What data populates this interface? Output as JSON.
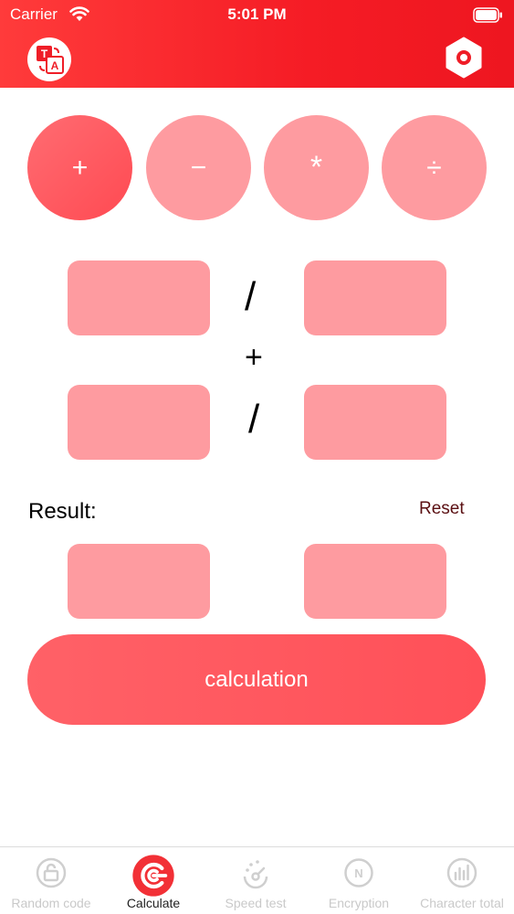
{
  "status_bar": {
    "carrier": "Carrier",
    "time": "5:01 PM"
  },
  "header": {
    "translate_icon": "translate-icon",
    "settings_icon": "hexagon-settings-icon"
  },
  "operators": [
    {
      "symbol": "+",
      "icon": "plus-icon",
      "selected": true
    },
    {
      "symbol": "−",
      "icon": "minus-icon",
      "selected": false
    },
    {
      "symbol": "*",
      "icon": "multiply-icon",
      "selected": false
    },
    {
      "symbol": "÷",
      "icon": "divide-icon",
      "selected": false
    }
  ],
  "fraction1": {
    "numerator": "",
    "denominator": "",
    "separator": "/"
  },
  "operation_symbol": "+",
  "fraction2": {
    "numerator": "",
    "denominator": "",
    "separator": "/"
  },
  "result": {
    "label": "Result:",
    "reset_label": "Reset",
    "numerator": "",
    "denominator": ""
  },
  "calculate_button": {
    "label": "calculation"
  },
  "tabs": [
    {
      "label": "Random code",
      "icon": "random-code-icon",
      "active": false
    },
    {
      "label": "Calculate",
      "icon": "calculate-icon",
      "active": true
    },
    {
      "label": "Speed test",
      "icon": "speed-test-icon",
      "active": false
    },
    {
      "label": "Encryption",
      "icon": "encryption-icon",
      "active": false
    },
    {
      "label": "Character total",
      "icon": "character-total-icon",
      "active": false
    }
  ],
  "colors": {
    "accent": "#f51c25",
    "pink_fill": "#fe9ba0",
    "button": "#ff5a60",
    "reset_text": "#5a0f12"
  }
}
